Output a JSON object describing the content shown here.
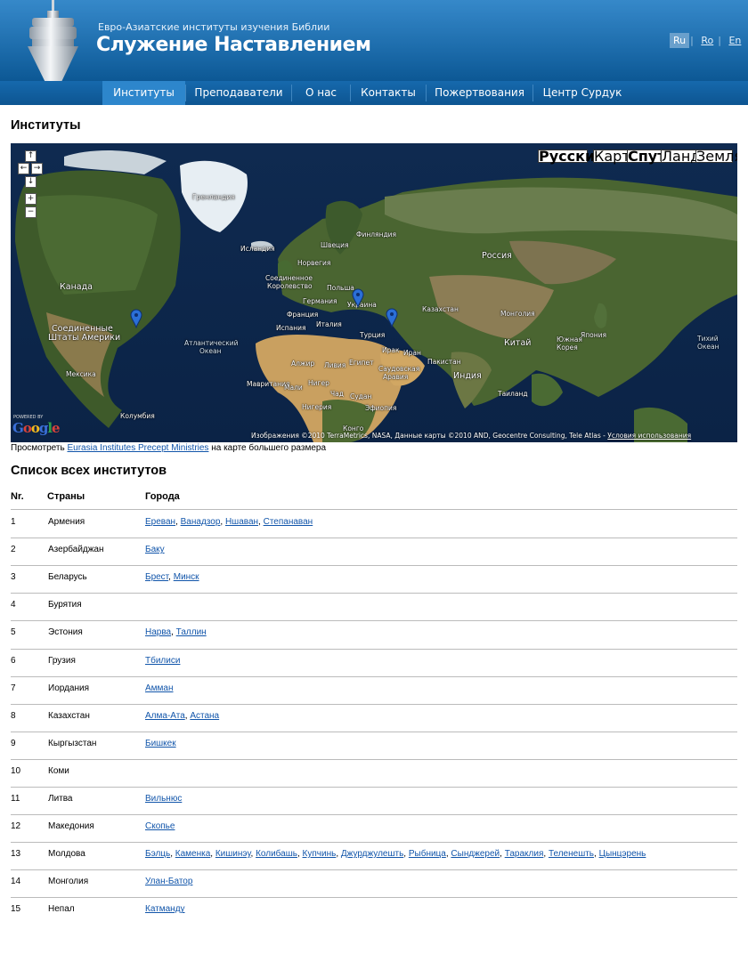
{
  "header": {
    "subtitle": "Евро-Азиатские институты изучения Библии",
    "site_title": "Служение Наставлением",
    "languages": [
      {
        "label": "Ru",
        "active": true
      },
      {
        "label": "Ro",
        "active": false
      },
      {
        "label": "En",
        "active": false
      }
    ]
  },
  "nav": {
    "items": [
      "Институты",
      "Преподаватели",
      "О нас",
      "Контакты",
      "Пожертвования",
      "Центр Сурдук"
    ],
    "active": "Институты"
  },
  "page_title": "Институты",
  "map": {
    "map_types": [
      "Русский",
      "Карта",
      "Спут.",
      "Ланд.",
      "Земля"
    ],
    "selected_type": "Спут.",
    "nav_controls": [
      "↑",
      "←",
      "→",
      "↓",
      "+",
      "−"
    ],
    "labels": {
      "greenland": "Гренландия",
      "iceland": "Исландия",
      "finland": "Финляндия",
      "sweden": "Швеция",
      "norway": "Норвегия",
      "uk1": "Соединенное",
      "uk2": "Королевство",
      "germany": "Германия",
      "poland": "Польша",
      "ukraine": "Украина",
      "france": "Франция",
      "spain": "Испания",
      "italy": "Италия",
      "turkey": "Турция",
      "kazakhstan": "Казахстан",
      "mongolia": "Монголия",
      "russia": "Россия",
      "china": "Китай",
      "japan": "Япония",
      "korea1": "Южная",
      "korea2": "Корея",
      "canada": "Канада",
      "usa1": "Соединенные",
      "usa2": "Штаты Америки",
      "mexico": "Мексика",
      "colombia": "Колумбия",
      "atlantic1": "Атлантический",
      "atlantic2": "Океан",
      "pacific1": "Тихий",
      "pacific2": "Океан",
      "algeria": "Алжир",
      "libya": "Ливия",
      "egypt": "Египет",
      "saudi1": "Саудовская",
      "saudi2": "Аравия",
      "iraq": "Ирак",
      "iran": "Иран",
      "pakistan": "Пакистан",
      "india": "Индия",
      "thailand": "Таиланд",
      "mauritania": "Мавритания",
      "mali": "Мали",
      "niger": "Нигер",
      "chad": "Чад",
      "sudan": "Судан",
      "nigeria": "Нигерия",
      "ethiopia": "Эфиопия",
      "congo": "Конго"
    },
    "copyright": "Изображения ©2010 TerraMetrics, NASA, Данные карты ©2010 AND, Geocentre Consulting, Tele Atlas -",
    "terms": "Условия использования",
    "powered_by": "POWERED BY",
    "google": "Google"
  },
  "larger_map": {
    "prefix": "Просмотреть",
    "link": "Eurasia Institutes Precept Ministries",
    "suffix": "на карте большего размера"
  },
  "list_title": "Список всех институтов",
  "table": {
    "headers": [
      "Nr.",
      "Страны",
      "Города"
    ],
    "rows": [
      {
        "nr": "1",
        "country": "Армения",
        "cities": [
          "Ереван",
          "Ванадзор",
          "Ншаван",
          "Степанаван"
        ]
      },
      {
        "nr": "2",
        "country": "Азербайджан",
        "cities": [
          "Баку"
        ]
      },
      {
        "nr": "3",
        "country": "Беларусь",
        "cities": [
          "Брест",
          "Минск"
        ]
      },
      {
        "nr": "4",
        "country": "Бурятия",
        "cities": []
      },
      {
        "nr": "5",
        "country": "Эстония",
        "cities": [
          "Нарва",
          "Таллин"
        ]
      },
      {
        "nr": "6",
        "country": "Грузия",
        "cities": [
          "Тбилиси"
        ]
      },
      {
        "nr": "7",
        "country": "Иордания",
        "cities": [
          "Амман"
        ]
      },
      {
        "nr": "8",
        "country": "Казахстан",
        "cities": [
          "Алма-Ата",
          "Астана"
        ]
      },
      {
        "nr": "9",
        "country": "Кыргызстан",
        "cities": [
          "Бишкек"
        ]
      },
      {
        "nr": "10",
        "country": "Коми",
        "cities": []
      },
      {
        "nr": "11",
        "country": "Литва",
        "cities": [
          "Вильнюс"
        ]
      },
      {
        "nr": "12",
        "country": "Македония",
        "cities": [
          "Скопье"
        ]
      },
      {
        "nr": "13",
        "country": "Молдова",
        "cities": [
          "Бэлць",
          "Каменка",
          "Кишинэу",
          "Колибашь",
          "Купчинь",
          "Джурджулешть",
          "Рыбница",
          "Сынджерей",
          "Тараклия",
          "Теленешть",
          "Цынцэрень"
        ]
      },
      {
        "nr": "14",
        "country": "Монголия",
        "cities": [
          "Улан-Батор"
        ]
      },
      {
        "nr": "15",
        "country": "Непал",
        "cities": [
          "Катманду"
        ]
      }
    ]
  }
}
